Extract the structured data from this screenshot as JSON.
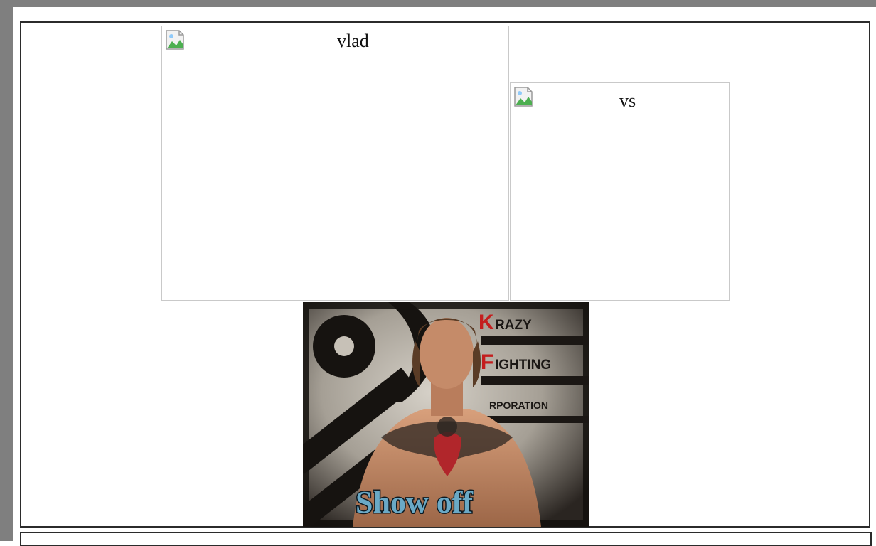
{
  "colors": {
    "frame_gray": "#7f7f7f",
    "table_border": "#2b2b2b",
    "image_border": "#c9c9c9"
  },
  "images": {
    "left": {
      "alt": "vlad",
      "icon": "broken-image-icon"
    },
    "right": {
      "alt": "vs",
      "icon": "broken-image-icon"
    }
  },
  "poster": {
    "brand_lines": [
      "KRAZY",
      "FIGHTING",
      "CORPORATION"
    ],
    "brand_visible_text": [
      "RAZY",
      "IGHTING",
      "RPORATION"
    ],
    "caption": "Show off",
    "colors": {
      "accent_red": "#c41e1e",
      "caption_fill": "#6aa9c6",
      "caption_stroke": "#0d1a22",
      "skin": "#c98e6c",
      "wall": "#bdb7ad",
      "dark": "#141210"
    }
  }
}
